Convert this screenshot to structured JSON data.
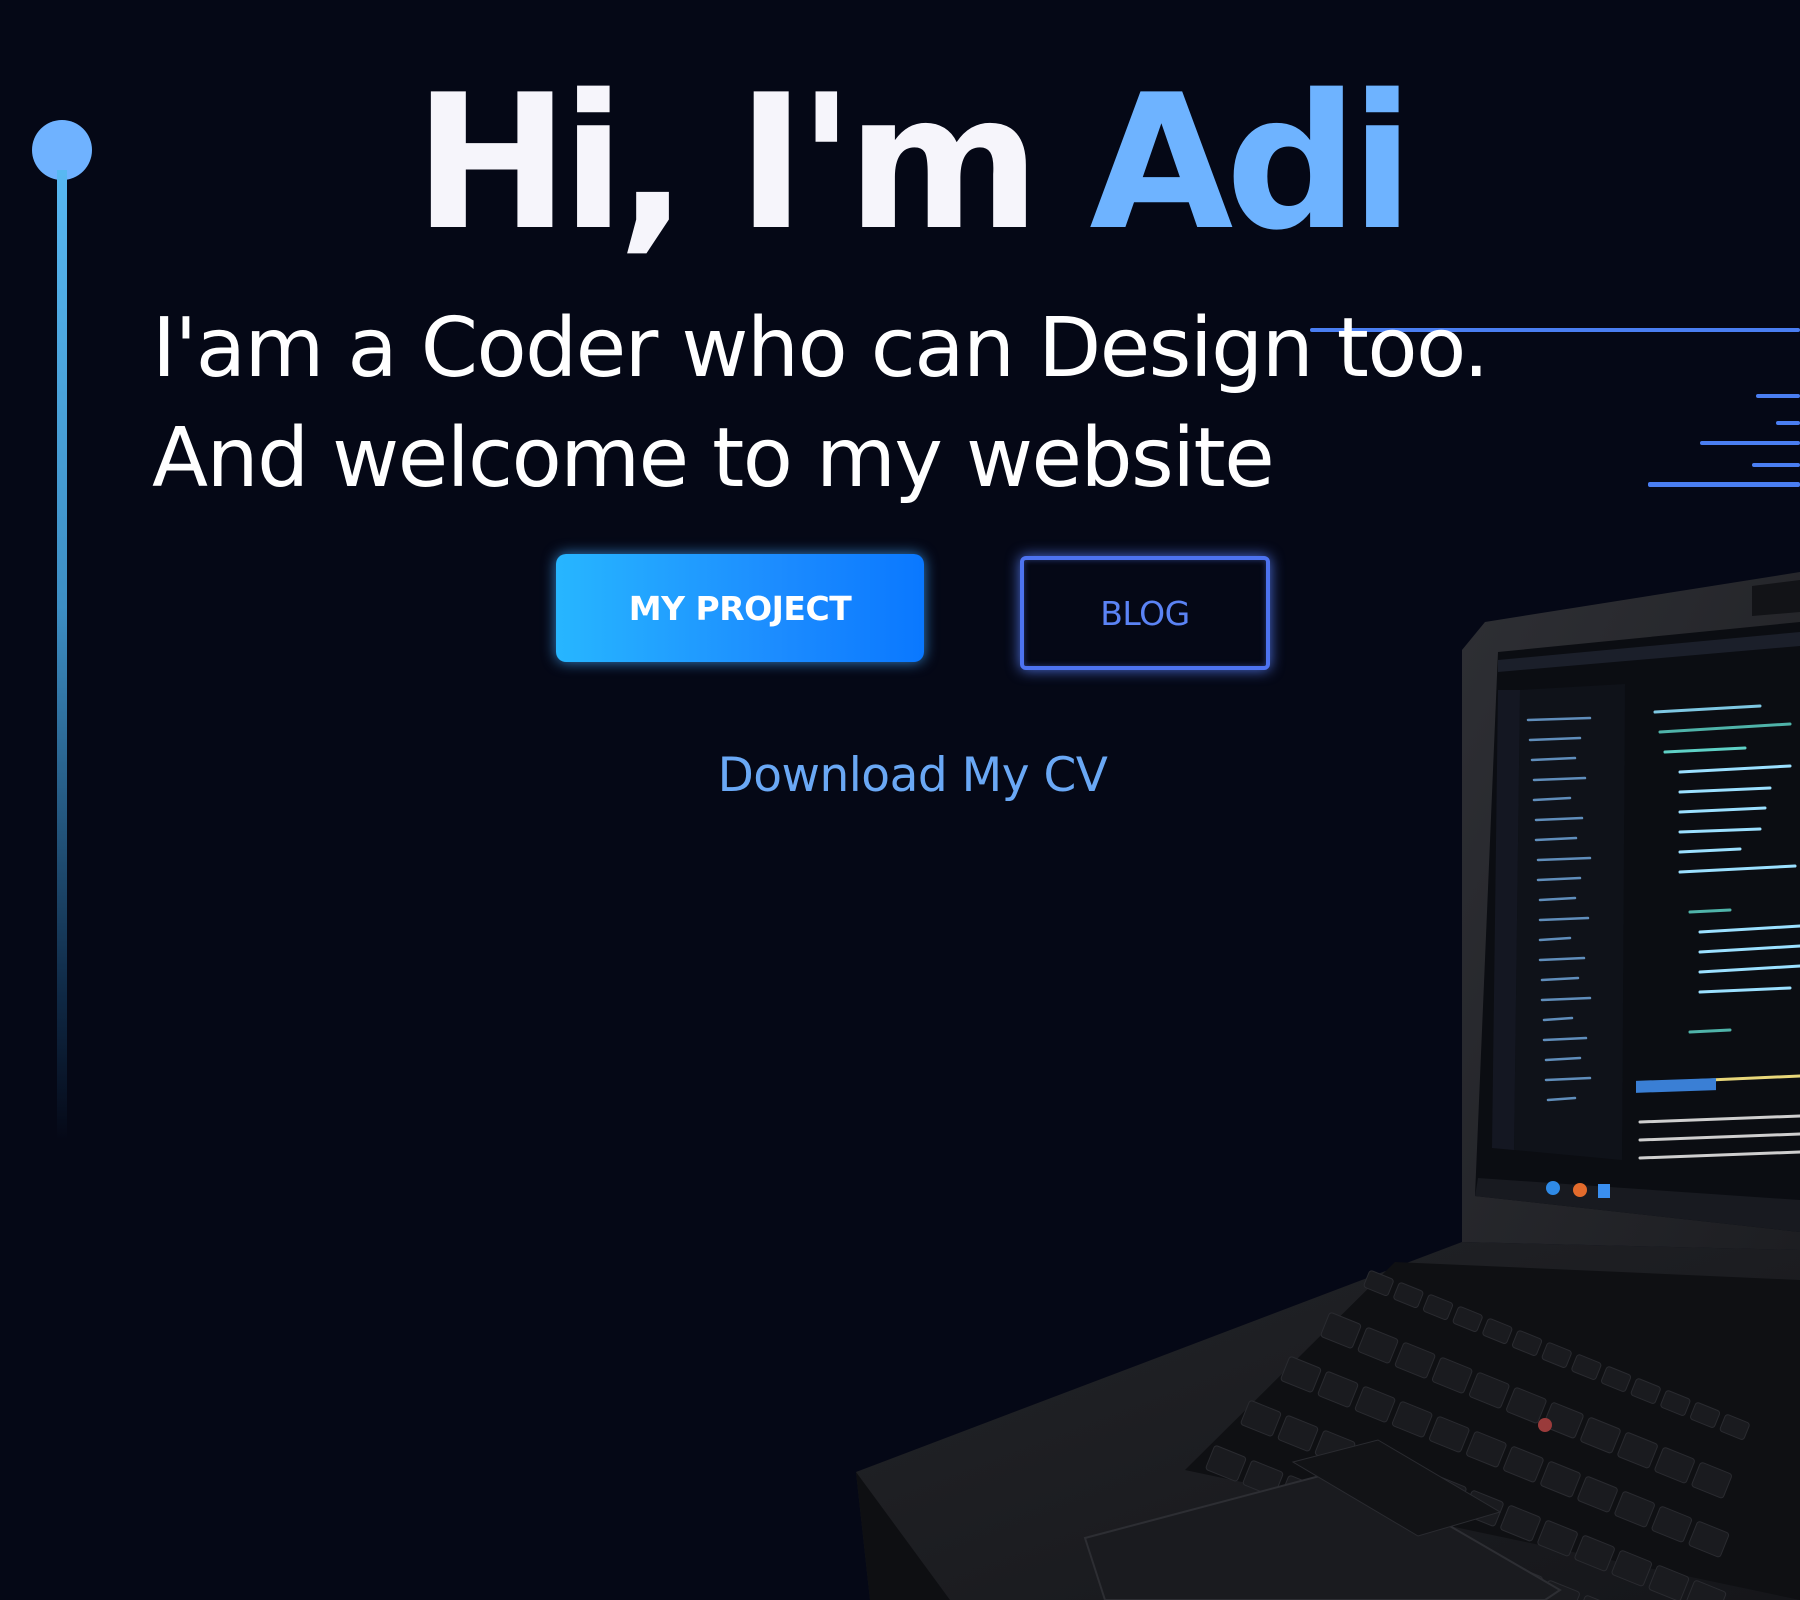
{
  "hero": {
    "greeting": "Hi, I'm",
    "name": "Adi",
    "tagline_line1": "I'am a Coder who can Design too.",
    "tagline_line2": "And welcome to my website"
  },
  "buttons": {
    "primary_label": "MY PROJECT",
    "secondary_label": "BLOG"
  },
  "cv_link": {
    "label": "Download My CV"
  },
  "colors": {
    "background": "#050816",
    "accent": "#6eb3ff",
    "primary_button": "#1c8cff",
    "outline_button": "#4d73f0"
  },
  "icons": [
    "timeline-dot",
    "laptop-illustration"
  ]
}
